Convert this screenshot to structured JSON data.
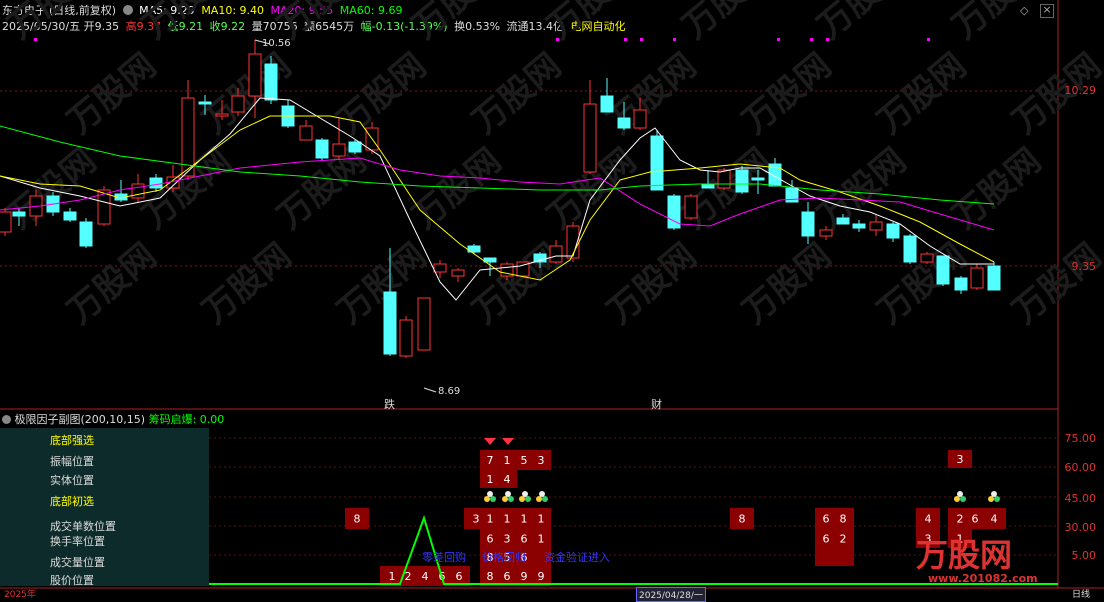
{
  "header": {
    "stock_name": "东方电子",
    "period_mode": "(日线,前复权)",
    "ma5": "MA5: 9.29",
    "ma10": "MA10: 9.40",
    "ma20": "MA20: 9.55",
    "ma60": "MA60: 9.69",
    "date": "2025/05/30/五",
    "open": "开9.35",
    "high": "高9.37",
    "low": "低9.21",
    "close": "收9.22",
    "volume": "量70756",
    "amount": "额6545万",
    "change": "幅-0.13(-1.39%)",
    "turnover": "换0.53%",
    "float": "流通13.4亿",
    "concept": "电网自动化"
  },
  "price_axis": {
    "high": "10.29",
    "low": "9.35"
  },
  "price_annotations": {
    "peak": "10.56",
    "trough": "8.69",
    "mark_left": "跌",
    "mark_right": "财"
  },
  "sub_chart": {
    "title": "极限因子副图(200,10,15)",
    "extra": "筹码启爆: 0.00",
    "axis": [
      "75.00",
      "60.00",
      "45.00",
      "30.00",
      "5.00"
    ],
    "labels": [
      "底部强选",
      "振幅位置",
      "实体位置",
      "底部初选",
      "成交单数位置",
      "换手率位置",
      "成交量位置",
      "股价位置"
    ],
    "blue_notes": [
      "零差回购",
      "价格回归",
      "资金验证进入"
    ]
  },
  "watermark": "万股网",
  "watermark_url": "www.201082.com",
  "bottom": {
    "left": "2025年",
    "date": "2025/04/28/一",
    "right": "日线"
  },
  "colors": {
    "up": "#ff3232",
    "down": "#54ffff",
    "ma5": "#ffffff",
    "ma10": "#ffff00",
    "ma20": "#ff00ff",
    "ma60": "#00ff00"
  }
}
